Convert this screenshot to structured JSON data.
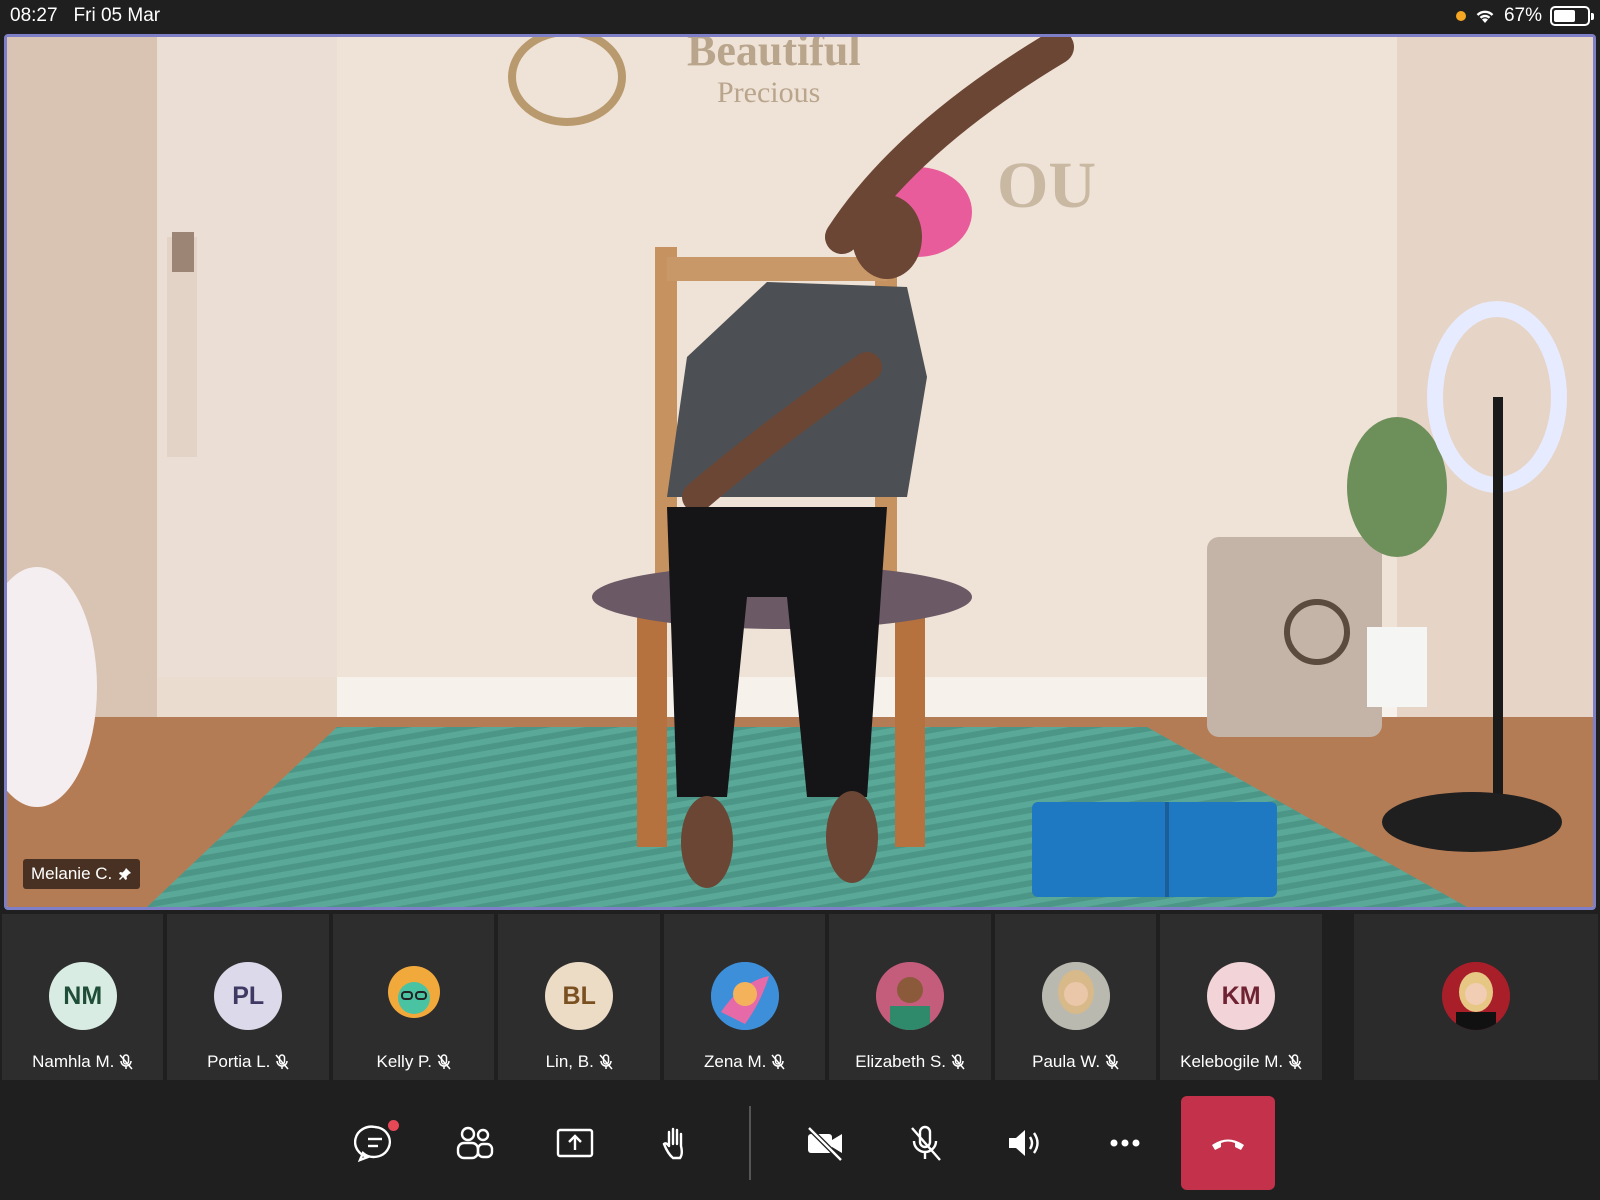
{
  "status_bar": {
    "time": "08:27",
    "date": "Fri 05 Mar",
    "battery": "67%",
    "battery_level": 0.67
  },
  "main_video": {
    "speaker_name": "Melanie C.",
    "pinned_icon": "pin-icon"
  },
  "participants": [
    {
      "initials": "NM",
      "name": "Namhla M.",
      "avatar_bg": "#d9ece3",
      "avatar_fg": "#1e4d38",
      "type": "initials"
    },
    {
      "initials": "PL",
      "name": "Portia L.",
      "avatar_bg": "#dcd9ea",
      "avatar_fg": "#3f3a63",
      "type": "initials"
    },
    {
      "initials": "",
      "name": "Kelly P.",
      "avatar_bg": "#f2a93b",
      "type": "photo"
    },
    {
      "initials": "BL",
      "name": "Lin, B.",
      "avatar_bg": "#ecdcc6",
      "avatar_fg": "#7a5020",
      "type": "initials"
    },
    {
      "initials": "",
      "name": "Zena M.",
      "avatar_bg": "#3d8fd9",
      "type": "photo"
    },
    {
      "initials": "",
      "name": "Elizabeth S.",
      "avatar_bg": "#b24a6a",
      "type": "photo"
    },
    {
      "initials": "",
      "name": "Paula W.",
      "avatar_bg": "#a8a8a0",
      "type": "photo"
    },
    {
      "initials": "KM",
      "name": "Kelebogile M.",
      "avatar_bg": "#f1d3d8",
      "avatar_fg": "#6e2232",
      "type": "initials"
    }
  ],
  "self_tile": {
    "avatar_bg": "#a81f2a"
  },
  "toolbar": {
    "buttons": [
      "chat-icon",
      "participants-icon",
      "share-screen-icon",
      "raise-hand-icon",
      "camera-off-icon",
      "mic-off-icon",
      "speaker-icon",
      "more-icon",
      "hang-up-icon"
    ],
    "hangup_color": "#c4314b"
  }
}
